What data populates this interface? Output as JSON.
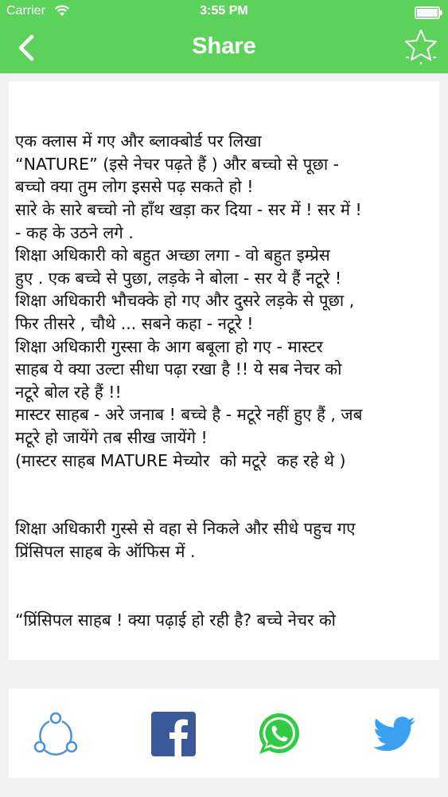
{
  "status_bar": {
    "carrier": "Carrier",
    "time": "3:55 PM"
  },
  "nav": {
    "title": "Share",
    "back_icon": "chevron-left-icon",
    "favorite_icon": "star-icon"
  },
  "story": {
    "lines": [
      "",
      "",
      "एक क्लास में गए और ब्लाक्बोर्ड पर लिखा",
      "“NATURE” (इसे नेचर पढ़ते हैं ) और बच्चो से पूछा -",
      "बच्चो क्या तुम लोग इससे पढ़ सकते हो !",
      "सारे के सारे बच्चो नो हाँथ खड़ा कर दिया - सर में ! सर में !",
      "- कह के उठने लगे .",
      "शिक्षा अधिकारी को बहुत अच्छा लगा - वो बहुत इम्प्रेस",
      "हुए . एक बच्चे से पुछा, लड़के ने बोला - सर ये हैं नटूरे !",
      "शिक्षा अधिकारी भौचक्के हो गए और दुसरे लड़के से पूछा ,",
      "फिर तीसरे , चौथे ... सबने कहा - नटूरे !",
      "शिक्षा अधिकारी गुस्सा के आग बबूला हो गए - मास्टर",
      "साहब ये क्या उल्टा सीधा पढ़ा रखा है !! ये सब नेचर को",
      "नटूरे बोल रहे हैं !!",
      "मास्टर साहब - अरे जनाब ! बच्चे है - मटूरे नहीं हुए हैं , जब",
      "मटूरे हो जायेंगे तब सीख जायेंगे !",
      "(मास्टर साहब MATURE मेच्योर  को मटूरे  कह रहे थे )",
      "",
      "",
      "शिक्षा अधिकारी गुस्से से वहा से निकले और सीधे पहुच गए",
      "प्रिंसिपल साहब के ऑफिस में .",
      "",
      "",
      "“प्रिंसिपल साहब ! क्या पढ़ाई हो रही है? बच्चे नेचर को"
    ]
  },
  "share_bar": {
    "buttons": [
      {
        "name": "share-generic-button",
        "icon": "share-nodes-icon",
        "color": "#4a90e2"
      },
      {
        "name": "facebook-button",
        "icon": "facebook-icon",
        "color": "#3b5998"
      },
      {
        "name": "whatsapp-button",
        "icon": "whatsapp-icon",
        "color": "#2ecc40"
      },
      {
        "name": "twitter-button",
        "icon": "twitter-icon",
        "color": "#3aa1f2"
      }
    ]
  },
  "colors": {
    "nav_background": "#5dd25b",
    "page_background": "#f2f2f2"
  }
}
